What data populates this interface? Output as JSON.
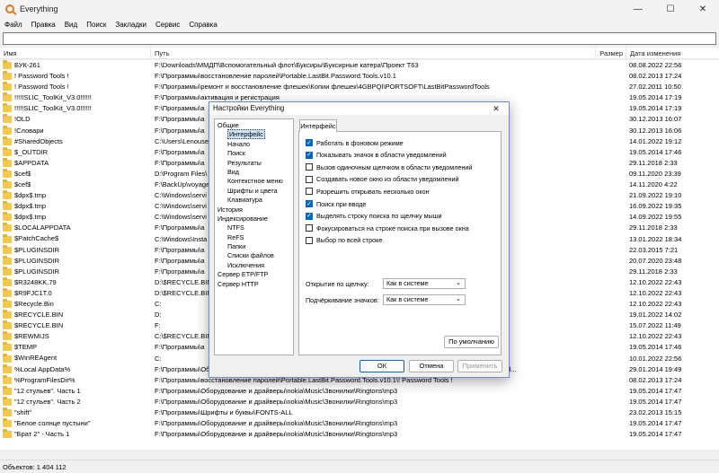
{
  "window": {
    "title": "Everything"
  },
  "menu": [
    "Файл",
    "Правка",
    "Вид",
    "Поиск",
    "Закладки",
    "Сервис",
    "Справка"
  ],
  "columns": {
    "name": "Имя",
    "path": "Путь",
    "size": "Размер",
    "date": "Дата изменения"
  },
  "rows": [
    {
      "name": "БУК-261",
      "path": "F:\\Downloads\\ММДП\\Вспомогательный флот\\Буксиры\\Буксирные катера\\Проект Т63",
      "date": "08.08.2022 22:56"
    },
    {
      "name": "! Password Tools !",
      "path": "F:\\Программы\\восстановление паролей\\Portable.LastBit.Password.Tools.v10.1",
      "date": "08.02.2013 17:24"
    },
    {
      "name": "! Password Tools !",
      "path": "F:\\Программы\\ремонт и восстановление флешек\\Копии флешек\\4GBPQI\\PORTSOFT\\LastBitPasswordTools",
      "date": "27.02.2011 10:50"
    },
    {
      "name": "!!!!!SLIC_ToolKit_V3.0!!!!!!",
      "path": "F:\\Программы\\активация и регистрация",
      "date": "19.05.2014 17:19"
    },
    {
      "name": "!!!!!SLIC_ToolKit_V3.0!!!!!!",
      "path": "F:\\Программы\\a",
      "date": "19.05.2014 17:19"
    },
    {
      "name": "!OLD",
      "path": "F:\\Программы\\a",
      "date": "30.12.2013 16:07"
    },
    {
      "name": "!Словари",
      "path": "F:\\Программы\\a",
      "date": "30.12.2013 16:06"
    },
    {
      "name": "#SharedObjects",
      "path": "C:\\Users\\Lenouse",
      "date": "14.01.2022 19:12"
    },
    {
      "name": "$_OUTDIR",
      "path": "F:\\Программы\\a",
      "date": "19.05.2014 17:46"
    },
    {
      "name": "$APPDATA",
      "path": "F:\\Программы\\a",
      "date": "29.11.2018 2:33"
    },
    {
      "name": "$cef$",
      "path": "D:\\Program Files\\",
      "date": "09.11.2020 23:39"
    },
    {
      "name": "$cef$",
      "path": "F:\\BackUp\\voyage",
      "date": "14.11.2020 4:22"
    },
    {
      "name": "$dpx$.tmp",
      "path": "C:\\Windows\\servi",
      "date": "21.09.2022 19:10"
    },
    {
      "name": "$dpx$.tmp",
      "path": "C:\\Windows\\servi",
      "date": "16.09.2022 19:35"
    },
    {
      "name": "$dpx$.tmp",
      "path": "C:\\Windows\\servi",
      "date": "14.09.2022 19:55"
    },
    {
      "name": "$LOCALAPPDATA",
      "path": "F:\\Программы\\a",
      "date": "29.11.2018 2:33"
    },
    {
      "name": "$PatchCache$",
      "path": "C:\\Windows\\Insta",
      "date": "13.01.2022 18:34"
    },
    {
      "name": "$PLUGINSDIR",
      "path": "F:\\Программы\\a",
      "date": "22.03.2015 7:21"
    },
    {
      "name": "$PLUGINSDIR",
      "path": "F:\\Программы\\a",
      "date": "20.07.2020 23:48"
    },
    {
      "name": "$PLUGINSDIR",
      "path": "F:\\Программы\\a",
      "date": "29.11.2018 2:33"
    },
    {
      "name": "$R3248KK.79",
      "path": "D:\\$RECYCLE.BIN",
      "date": "12.10.2022 22:43"
    },
    {
      "name": "$R9FJC1T.0",
      "path": "D:\\$RECYCLE.BIN",
      "date": "12.10.2022 22:43"
    },
    {
      "name": "$Recycle.Bin",
      "path": "C:",
      "date": "12.10.2022 22:43"
    },
    {
      "name": "$RECYCLE.BIN",
      "path": "D:",
      "date": "19.01.2022 14:02"
    },
    {
      "name": "$RECYCLE.BIN",
      "path": "F:",
      "date": "15.07.2022 11:49"
    },
    {
      "name": "$REWMIJS",
      "path": "C:\\$RECYCLE.BIN",
      "date": "12.10.2022 22:43"
    },
    {
      "name": "$TEMP",
      "path": "F:\\Программы\\a",
      "date": "19.05.2014 17:46"
    },
    {
      "name": "$WinREAgent",
      "path": "C:",
      "date": "10.01.2022 22:56"
    },
    {
      "name": "%Local AppData%",
      "path": "F:\\Программы\\Оборудование и драйверы\\samsung\\BadaSoft\\faxteR\\WaveBada tools\\WaveBada tools\\SoftBAda\\Bad...",
      "date": "29.01.2014 19:49"
    },
    {
      "name": "%ProgramFilesDir%",
      "path": "F:\\Программы\\восстановление паролей\\Portable.LastBit.Password.Tools.v10.1\\! Password Tools !",
      "date": "08.02.2013 17:24"
    },
    {
      "name": "\"12 стульев\". Часть 1",
      "path": "F:\\Программы\\Оборудование и драйверы\\nokia\\Music\\Звонилки\\Ringtons\\mp3",
      "date": "19.05.2014 17:47"
    },
    {
      "name": "\"12 стульев\". Часть 2",
      "path": "F:\\Программы\\Оборудование и драйверы\\nokia\\Music\\Звонилки\\Ringtons\\mp3",
      "date": "19.05.2014 17:47"
    },
    {
      "name": "\"shift\"",
      "path": "F:\\Программы\\Шрифты и буквы\\FONTS-ALL",
      "date": "23.02.2013 15:15"
    },
    {
      "name": "\"Белое солнце пустыни\"",
      "path": "F:\\Программы\\Оборудование и драйверы\\nokia\\Music\\Звонилки\\Ringtons\\mp3",
      "date": "19.05.2014 17:47"
    },
    {
      "name": "\"Брат 2\" - Часть 1",
      "path": "F:\\Программы\\Оборудование и драйверы\\nokia\\Music\\Звонилки\\Ringtons\\mp3",
      "date": "19.05.2014 17:47"
    }
  ],
  "status": "Объектов: 1 404 112",
  "dialog": {
    "title": "Настройки Everything",
    "tab": "Интерфейс",
    "tree": [
      {
        "label": "Общие",
        "indent": 0,
        "selected": false
      },
      {
        "label": "Интерфейс",
        "indent": 1,
        "selected": true
      },
      {
        "label": "Начало",
        "indent": 1,
        "selected": false
      },
      {
        "label": "Поиск",
        "indent": 1,
        "selected": false
      },
      {
        "label": "Результаты",
        "indent": 1,
        "selected": false
      },
      {
        "label": "Вид",
        "indent": 1,
        "selected": false
      },
      {
        "label": "Контекстное меню",
        "indent": 1,
        "selected": false
      },
      {
        "label": "Шрифты и цвета",
        "indent": 1,
        "selected": false
      },
      {
        "label": "Клавиатура",
        "indent": 1,
        "selected": false
      },
      {
        "label": "История",
        "indent": 0,
        "selected": false
      },
      {
        "label": "Индексирование",
        "indent": 0,
        "selected": false
      },
      {
        "label": "NTFS",
        "indent": 1,
        "selected": false
      },
      {
        "label": "ReFS",
        "indent": 1,
        "selected": false
      },
      {
        "label": "Папки",
        "indent": 1,
        "selected": false
      },
      {
        "label": "Списки файлов",
        "indent": 1,
        "selected": false
      },
      {
        "label": "Исключения",
        "indent": 1,
        "selected": false
      },
      {
        "label": "Сервер ETP/FTP",
        "indent": 0,
        "selected": false
      },
      {
        "label": "Сервер HTTP",
        "indent": 0,
        "selected": false
      }
    ],
    "checkboxes": [
      {
        "label": "Работать в фоновом режиме",
        "checked": true
      },
      {
        "label": "Показывать значок в области уведомлений",
        "checked": true
      },
      {
        "label": "Вызов одиночным щелчком в области уведомлений",
        "checked": false
      },
      {
        "label": "Создавать новое окно из области уведомлений",
        "checked": false
      },
      {
        "label": "Разрешить открывать несколько окон",
        "checked": false
      },
      {
        "label": "Поиск при вводе",
        "checked": true
      },
      {
        "label": "Выделять строку поиска по щелчку мыши",
        "checked": true
      },
      {
        "label": "Фокусироваться на строке поиска при вызове окна",
        "checked": false
      },
      {
        "label": "Выбор по всей строке",
        "checked": false
      }
    ],
    "open_label": "Открытие по щелчку:",
    "open_value": "Как в системе",
    "underline_label": "Подчёркивание значков:",
    "underline_value": "Как в системе",
    "default_button": "По умолчанию",
    "ok_button": "ОК",
    "cancel_button": "Отмена",
    "apply_button": "Применить"
  }
}
